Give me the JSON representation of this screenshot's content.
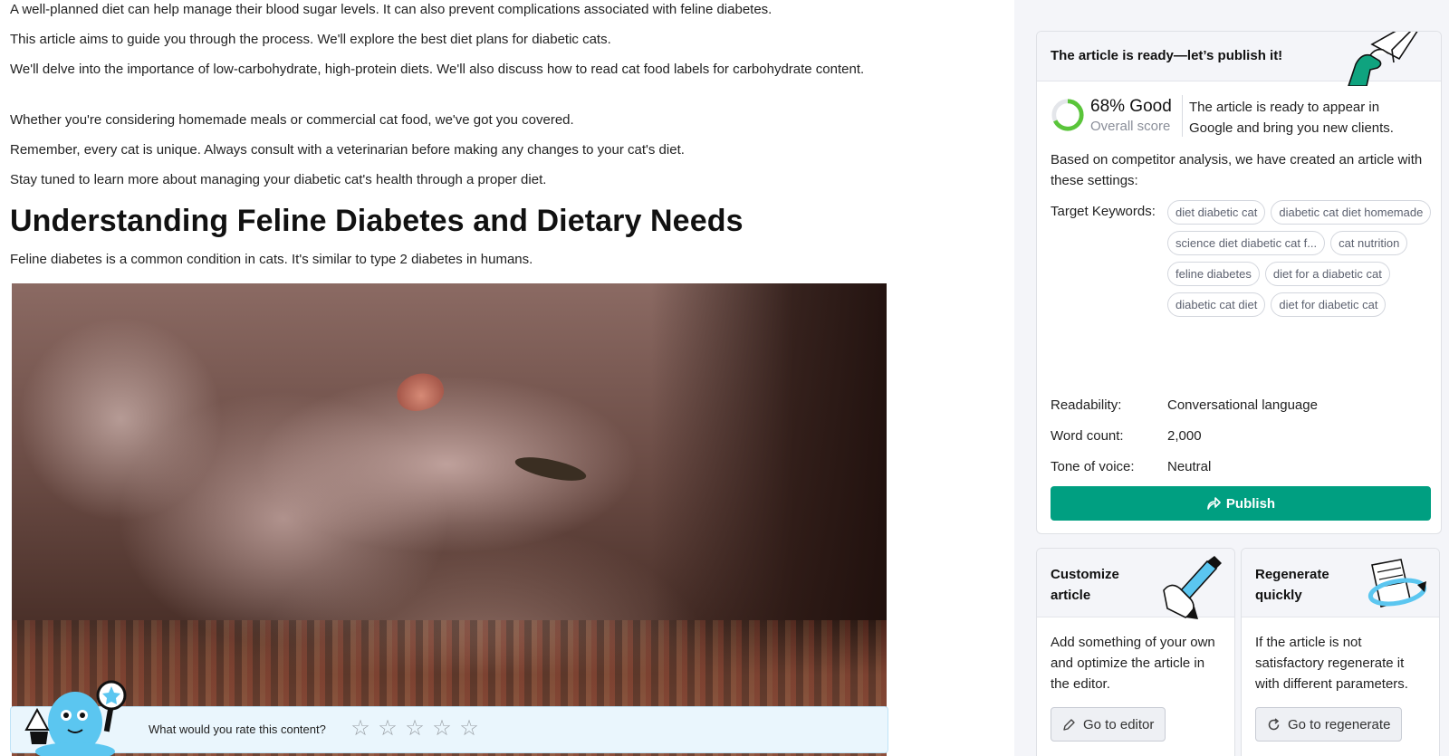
{
  "article": {
    "paragraphs_top": [
      "A well-planned diet can help manage their blood sugar levels. It can also prevent complications associated with feline diabetes.",
      "This article aims to guide you through the process. We'll explore the best diet plans for diabetic cats.",
      "We'll delve into the importance of low-carbohydrate, high-protein diets. We'll also discuss how to read cat food labels for carbohydrate content.",
      "Whether you're considering homemade meals or commercial cat food, we've got you covered.",
      "Remember, every cat is unique. Always consult with a veterinarian before making any changes to your cat's diet.",
      "Stay tuned to learn more about managing your diabetic cat's health through a proper diet."
    ],
    "heading": "Understanding Feline Diabetes and Dietary Needs",
    "paragraph_after_heading": "Feline diabetes is a common condition in cats. It's similar to type 2 diabetes in humans.",
    "rating": {
      "question": "What would you rate this content?",
      "max_stars": 5,
      "selected": 0
    }
  },
  "ready_card": {
    "title": "The article is ready—let’s publish it!",
    "score": {
      "value": "68% Good",
      "percent": 68,
      "label": "Overall score",
      "description": "The article is ready to appear in Google and bring you new clients.",
      "color": "#5ac53a"
    },
    "based_text": "Based on competitor analysis, we have created an article with these settings:",
    "keywords_label": "Target Keywords:",
    "keywords": [
      "diet diabetic cat",
      "diabetic cat diet homemade",
      "science diet diabetic cat f...",
      "cat nutrition",
      "feline diabetes",
      "diet for a diabetic cat",
      "diabetic cat diet",
      "diet for diabetic cat"
    ],
    "settings": {
      "readability_label": "Readability:",
      "readability_value": "Conversational language",
      "word_count_label": "Word count:",
      "word_count_value": "2,000",
      "tone_label": "Tone of voice:",
      "tone_value": "Neutral"
    },
    "publish_label": "Publish",
    "accent_color": "#009f81"
  },
  "customize_card": {
    "title": "Customize article",
    "text": "Add something of your own and optimize the article in the editor.",
    "button": "Go to editor"
  },
  "regenerate_card": {
    "title": "Regenerate quickly",
    "text": "If the article is not satisfactory regenerate it with different parameters.",
    "button": "Go to regenerate"
  }
}
